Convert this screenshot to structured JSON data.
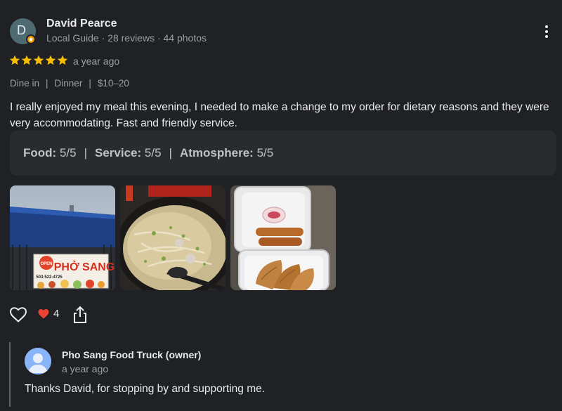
{
  "reviewer": {
    "initial": "D",
    "name": "David Pearce",
    "meta": "Local Guide · 28 reviews · 44 photos",
    "avatar_color": "#4f6b72",
    "badge_icon": "local-guide-star-icon"
  },
  "menu_icon": "more-vert-icon",
  "rating": {
    "stars": 5,
    "max_stars": 5,
    "star_color": "#fbbc04",
    "time": "a year ago"
  },
  "tags": {
    "service_type": "Dine in",
    "meal_type": "Dinner",
    "price": "$10–20"
  },
  "review_text": "I really enjoyed my meal this evening, I needed to make a change to my order for dietary reasons and they were very accommodating. Fast and friendly service.",
  "sub_ratings": [
    {
      "label": "Food:",
      "value": "5/5"
    },
    {
      "label": "Service:",
      "value": "5/5"
    },
    {
      "label": "Atmosphere:",
      "value": "5/5"
    }
  ],
  "photos": [
    {
      "icon": "food-truck-photo",
      "sign": {
        "open": "OPEN",
        "brand": "PHỞ SANG",
        "phone": "503-522-4725"
      }
    },
    {
      "icon": "pho-bowl-photo"
    },
    {
      "icon": "spring-rolls-dumplings-photo"
    }
  ],
  "actions": {
    "like_icon": "heart-outline-icon",
    "reaction_icon": "heart-red-icon",
    "reaction_count": "4",
    "share_icon": "share-icon"
  },
  "owner_reply": {
    "name": "Pho Sang Food Truck (owner)",
    "time": "a year ago",
    "text": "Thanks David, for stopping by and supporting me.",
    "avatar_icon": "person-avatar-icon",
    "avatar_color": "#8ab4f8"
  }
}
